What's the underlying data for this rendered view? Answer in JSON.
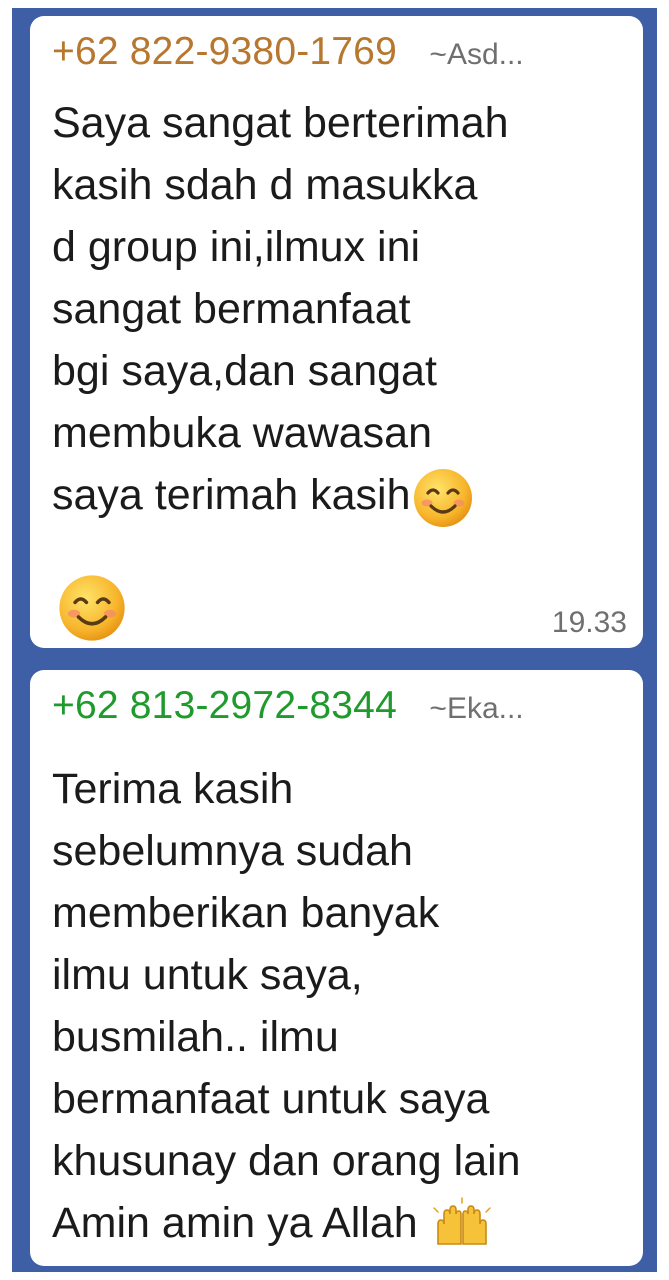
{
  "messages": [
    {
      "sender_phone": "+62 822-9380-1769",
      "sender_alias": "~Asd...",
      "body": "Saya sangat berterimah\nkasih sdah d masukka\nd group ini,ilmux ini\nsangat bermanfaat\nbgi saya,dan sangat\nmembuka wawasan",
      "last_line": "saya terimah kasih",
      "inline_emoji": "smiling-face-icon",
      "trailing_emoji": "smiling-face-icon",
      "time": "19.33",
      "phone_color": "#b7772e"
    },
    {
      "sender_phone": "+62 813-2972-8344",
      "sender_alias": "~Eka...",
      "body": "Terima kasih\nsebelumnya sudah\nmemberikan banyak\nilmu untuk saya,\nbusmilah.. ilmu\nbermanfaat untuk saya\nkhusunay dan  orang lain",
      "last_line": "Amin amin ya Allah",
      "inline_emoji": "raising-hands-icon",
      "phone_color": "#1f9a2c"
    }
  ],
  "colors": {
    "frame_blue": "#3e5fa6",
    "bubble_bg": "#ffffff",
    "text": "#1b1b1b",
    "meta": "#6f6f6f"
  }
}
